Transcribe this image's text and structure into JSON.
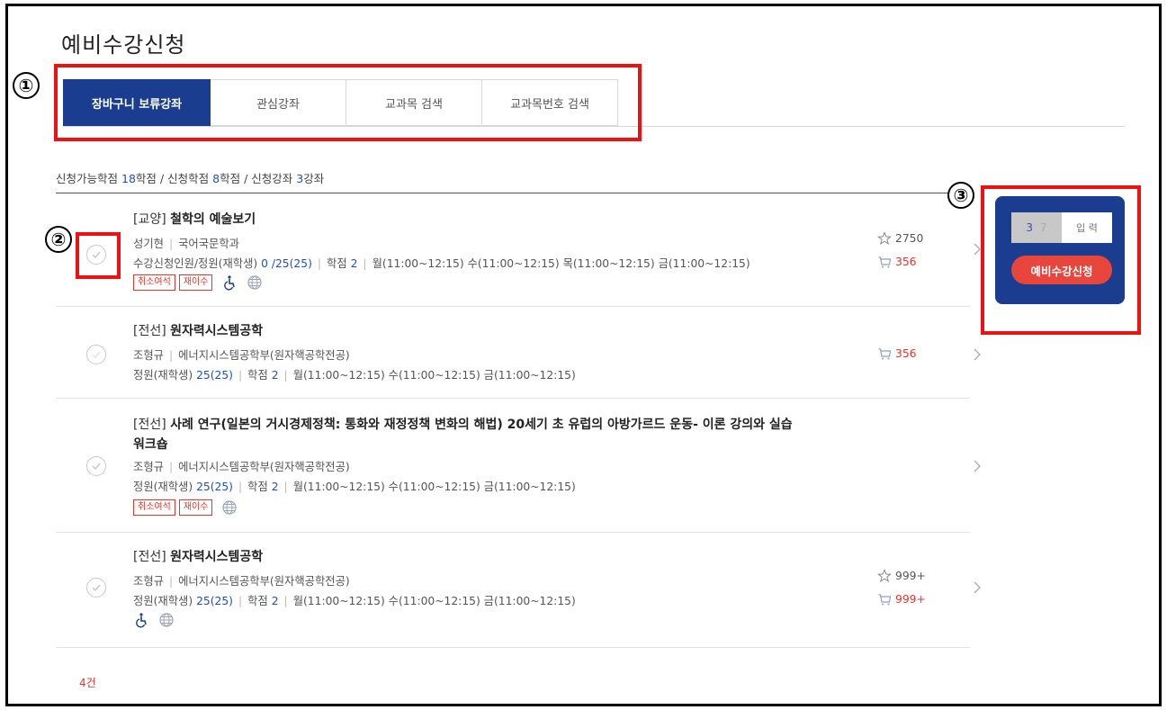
{
  "page": {
    "title": "예비수강신청"
  },
  "tabs": [
    {
      "label": "장바구니 보류강좌",
      "active": true
    },
    {
      "label": "관심강좌",
      "active": false
    },
    {
      "label": "교과목 검색",
      "active": false
    },
    {
      "label": "교과목번호 검색",
      "active": false
    }
  ],
  "summary": {
    "available_label": "신청가능학점",
    "available_value": "18",
    "available_unit": "학점",
    "applied_label": "신청학점",
    "applied_value": "8",
    "applied_unit": "학점",
    "courses_label": "신청강좌",
    "courses_value": "3",
    "courses_unit": "강좌",
    "separator": "/"
  },
  "courses": [
    {
      "category": "[교양]",
      "name": "철학의 예술보기",
      "professor": "성기현",
      "department": "국어국문학과",
      "capacity_label": "수강신청인원/정원(재학생)",
      "capacity_value": "0 /25(25)",
      "credit_label": "학점",
      "credit_value": "2",
      "schedule": "월(11:00~12:15) 수(11:00~12:15) 목(11:00~12:15) 금(11:00~12:15)",
      "tags": [
        "취소여석",
        "재이수"
      ],
      "icons": [
        "wheelchair-icon",
        "globe-icon"
      ],
      "interest_count": "2750",
      "cart_count": "356"
    },
    {
      "category": "[전선]",
      "name": "원자력시스템공학",
      "professor": "조형규",
      "department": "에너지시스템공학부(원자핵공학전공)",
      "capacity_label": "정원(재학생)",
      "capacity_value": "25(25)",
      "credit_label": "학점",
      "credit_value": "2",
      "schedule": "월(11:00~12:15) 수(11:00~12:15) 금(11:00~12:15)",
      "cart_count": "356"
    },
    {
      "category": "[전선]",
      "name_line1": "사례 연구(일본의 거시경제정책: 통화와 재정정책 변화의 해법) 20세기 초 유럽의 아방가르드 운동- 이론 강의와 실습",
      "name_line2": "워크숍",
      "professor": "조형규",
      "department": "에너지시스템공학부(원자핵공학전공)",
      "capacity_label": "정원(재학생)",
      "capacity_value": "25(25)",
      "credit_label": "학점",
      "credit_value": "2",
      "schedule": "월(11:00~12:15) 수(11:00~12:15) 금(11:00~12:15)",
      "tags": [
        "취소여석",
        "재이수"
      ],
      "icons": [
        "globe-icon"
      ]
    },
    {
      "category": "[전선]",
      "name": "원자력시스템공학",
      "professor": "조형규",
      "department": "에너지시스템공학부(원자핵공학전공)",
      "capacity_label": "정원(재학생)",
      "capacity_value": "25(25)",
      "credit_label": "학점",
      "credit_value": "2",
      "schedule": "월(11:00~12:15) 수(11:00~12:15) 금(11:00~12:15)",
      "icons": [
        "wheelchair-icon",
        "globe-icon"
      ],
      "interest_count": "999+",
      "cart_count": "999+"
    }
  ],
  "apply_panel": {
    "captcha_digit1": "3",
    "captcha_digit2": "7",
    "input_placeholder": "입 력",
    "button_label": "예비수강신청"
  },
  "result_count": "4건",
  "annotations": [
    "①",
    "②",
    "③"
  ],
  "colors": {
    "brand_navy": "#1b3d8f",
    "accent_red": "#e8453c",
    "link_blue": "#1f4fbf",
    "annotation_red": "#ee1111"
  }
}
